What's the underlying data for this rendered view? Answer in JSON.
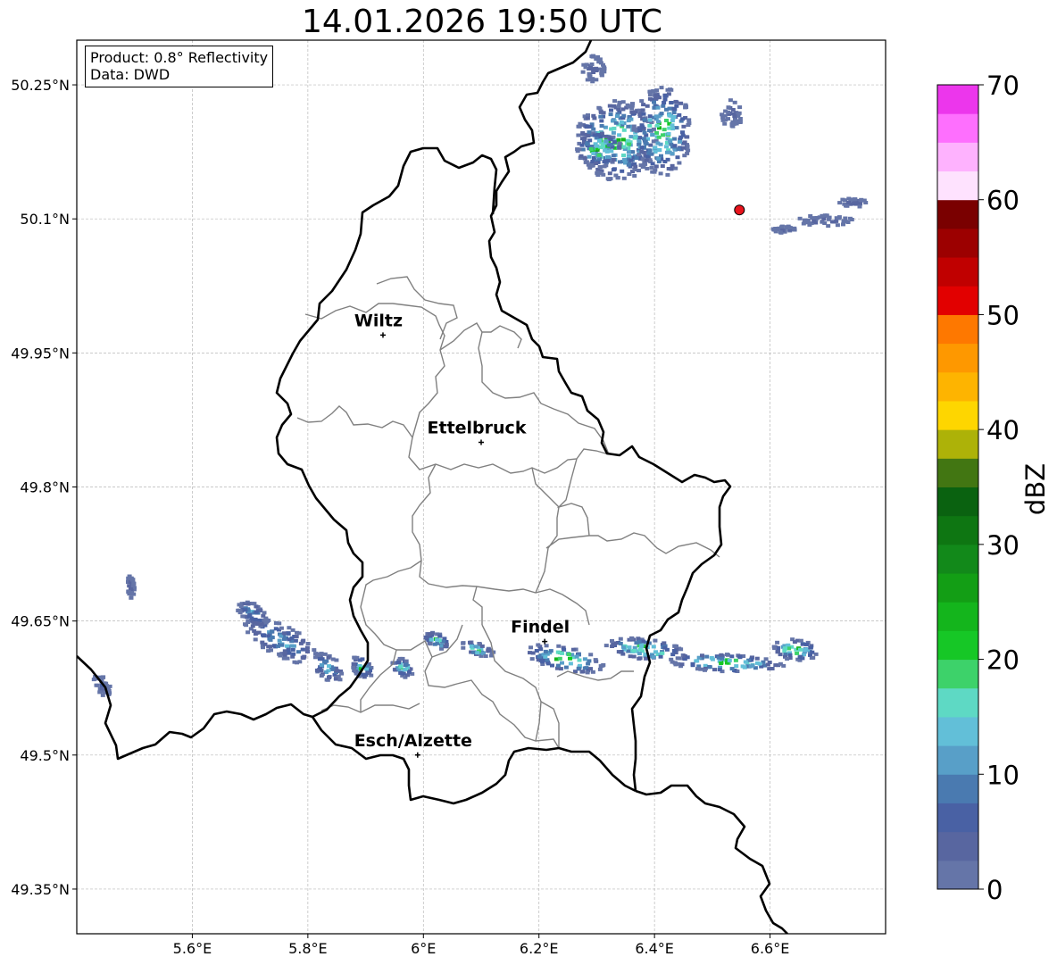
{
  "title": "14.01.2026 19:50 UTC",
  "info": {
    "product": "Product: 0.8° Reflectivity",
    "data": "Data: DWD"
  },
  "axes": {
    "lon_range": [
      5.4,
      6.8
    ],
    "lat_range": [
      49.3,
      50.3
    ],
    "lon_ticks": [
      {
        "value": 5.6,
        "label": "5.6°E"
      },
      {
        "value": 5.8,
        "label": "5.8°E"
      },
      {
        "value": 6.0,
        "label": "6°E"
      },
      {
        "value": 6.2,
        "label": "6.2°E"
      },
      {
        "value": 6.4,
        "label": "6.4°E"
      },
      {
        "value": 6.6,
        "label": "6.6°E"
      }
    ],
    "lat_ticks": [
      {
        "value": 50.25,
        "label": "50.25°N"
      },
      {
        "value": 50.1,
        "label": "50.1°N"
      },
      {
        "value": 49.95,
        "label": "49.95°N"
      },
      {
        "value": 49.8,
        "label": "49.8°N"
      },
      {
        "value": 49.65,
        "label": "49.65°N"
      },
      {
        "value": 49.5,
        "label": "49.5°N"
      },
      {
        "value": 49.35,
        "label": "49.35°N"
      }
    ],
    "grid": true
  },
  "cities": [
    {
      "name": "Wiltz",
      "lon": 5.93,
      "lat": 49.97
    },
    {
      "name": "Ettelbruck",
      "lon": 6.1,
      "lat": 49.85
    },
    {
      "name": "Findel",
      "lon": 6.21,
      "lat": 49.627
    },
    {
      "name": "Esch/Alzette",
      "lon": 5.99,
      "lat": 49.5
    }
  ],
  "radar_site": {
    "lon": 6.547,
    "lat": 50.11,
    "color": "#e8141c"
  },
  "colorbar": {
    "label": "dBZ",
    "min": 0,
    "max": 70,
    "step": 2.5,
    "ticks": [
      0,
      10,
      20,
      30,
      40,
      50,
      60,
      70
    ],
    "colors": [
      "#6575a8",
      "#5866a0",
      "#4961a4",
      "#4a7ab0",
      "#589fc8",
      "#62bfd8",
      "#5ed9c4",
      "#3dd26a",
      "#16c726",
      "#14b51c",
      "#139e15",
      "#12891a",
      "#0e7612",
      "#0a6210",
      "#427612",
      "#adb208",
      "#fed600",
      "#feb400",
      "#fe9800",
      "#fe7800",
      "#e20000",
      "#c00000",
      "#9c0000",
      "#7a0000",
      "#fee2fe",
      "#feb2fe",
      "#fe6ffe",
      "#ec36ec"
    ]
  },
  "chart_data": {
    "type": "heatmap",
    "title": "14.01.2026 19:50 UTC",
    "variable": "dBZ",
    "echoes": [
      {
        "region": "northeast cluster",
        "lon": [
          6.26,
          6.46
        ],
        "lat": [
          50.14,
          50.24
        ],
        "dbz_max": 25
      },
      {
        "region": "north-east edge",
        "lon": [
          6.47,
          6.79
        ],
        "lat": [
          50.08,
          50.28
        ],
        "dbz_max": 5
      },
      {
        "region": "southwest band",
        "lon": [
          5.67,
          5.84
        ],
        "lat": [
          49.58,
          49.68
        ],
        "dbz_max": 15
      },
      {
        "region": "south-central band",
        "lon": [
          5.88,
          6.13
        ],
        "lat": [
          49.58,
          49.64
        ],
        "dbz_max": 22
      },
      {
        "region": "southeast band",
        "lon": [
          6.15,
          6.68
        ],
        "lat": [
          49.58,
          49.64
        ],
        "dbz_max": 27
      },
      {
        "region": "far west",
        "lon": [
          5.42,
          5.5
        ],
        "lat": [
          49.56,
          49.71
        ],
        "dbz_max": 5
      }
    ]
  }
}
